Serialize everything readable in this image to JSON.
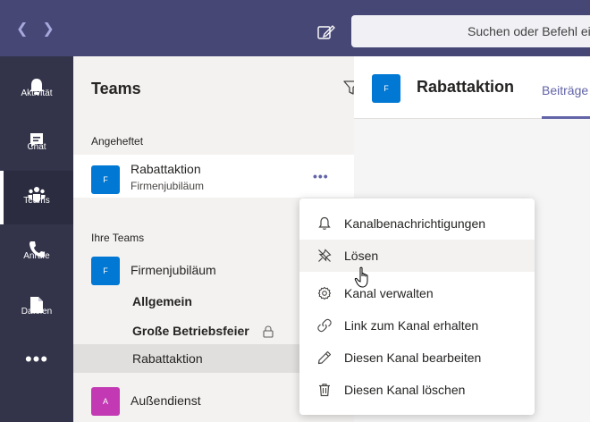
{
  "topbar": {
    "back_icon": "chevron-left-icon",
    "forward_icon": "chevron-right-icon",
    "compose_icon": "compose-icon",
    "search_placeholder": "Suchen oder Befehl eingeben",
    "colors": {
      "bar": "#464775",
      "search_bg": "#f0f0f5"
    }
  },
  "rail": {
    "items": [
      {
        "label": "Aktivität",
        "icon": "bell-icon"
      },
      {
        "label": "Chat",
        "icon": "chat-icon"
      },
      {
        "label": "Teams",
        "icon": "teams-icon",
        "active": true
      },
      {
        "label": "Anrufe",
        "icon": "phone-icon"
      },
      {
        "label": "Dateien",
        "icon": "file-icon"
      }
    ],
    "more_label": "•••",
    "colors": {
      "bg": "#33344a"
    }
  },
  "panel": {
    "title": "Teams",
    "filter_icon": "filter-icon",
    "pinned_label": "Angeheftet",
    "pinned_item": {
      "name": "Rabattaktion",
      "team": "Firmenjubiläum",
      "avatar_letter": "F",
      "more_label": "•••"
    },
    "your_teams_label": "Ihre Teams",
    "teams": [
      {
        "name": "Firmenjubiläum",
        "avatar_letter": "F",
        "avatar_color": "#0078d4",
        "channels": [
          {
            "name": "Allgemein",
            "bold": true
          },
          {
            "name": "Große Betriebsfeier",
            "bold": true,
            "private": true
          },
          {
            "name": "Rabattaktion",
            "active": true
          }
        ]
      },
      {
        "name": "Außendienst",
        "avatar_letter": "A",
        "avatar_color": "#c239b3"
      }
    ]
  },
  "main": {
    "avatar_letter": "F",
    "title": "Rabattaktion",
    "tab_label": "Beiträge"
  },
  "context_menu": {
    "items": [
      {
        "label": "Kanalbenachrichtigungen",
        "icon": "bell-icon"
      },
      {
        "label": "Lösen",
        "icon": "unpin-icon",
        "hover": true
      },
      {
        "label": "Kanal verwalten",
        "icon": "gear-icon"
      },
      {
        "label": "Link zum Kanal erhalten",
        "icon": "link-icon"
      },
      {
        "label": "Diesen Kanal bearbeiten",
        "icon": "pencil-icon"
      },
      {
        "label": "Diesen Kanal löschen",
        "icon": "trash-icon"
      }
    ]
  }
}
